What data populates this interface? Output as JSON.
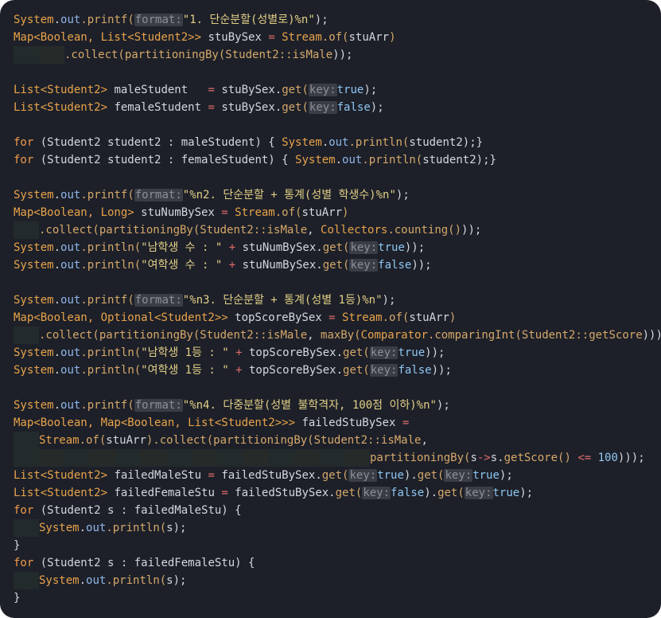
{
  "colors": {
    "background": "#1d2029",
    "type": "#e8a34a",
    "plain": "#d4d7de",
    "static_field": "#8fb6e8",
    "method": "#d6a86a",
    "string": "#e2cf86",
    "keyword": "#f09b4a",
    "number": "#8fc6f2",
    "operator": "#e06b6b",
    "hint": "#8b8f98"
  },
  "code_lines": [
    {
      "indent": 0,
      "tokens": [
        {
          "t": "System",
          "c": "type"
        },
        {
          "t": ".",
          "c": "plain"
        },
        {
          "t": "out",
          "c": "static_field"
        },
        {
          "t": ".printf(",
          "c": "method"
        },
        {
          "t": "format:",
          "c": "hint"
        },
        {
          "t": "\"1. 단순분할(성별로)%n\"",
          "c": "string"
        },
        {
          "t": ");",
          "c": "plain"
        }
      ]
    },
    {
      "indent": 0,
      "tokens": [
        {
          "t": "Map<Boolean, ",
          "c": "type"
        },
        {
          "t": "List<Student2>>",
          "c": "type"
        },
        {
          "t": " stuBySex ",
          "c": "plain"
        },
        {
          "t": "=",
          "c": "operator"
        },
        {
          "t": " Stream",
          "c": "type"
        },
        {
          "t": ".of(",
          "c": "method"
        },
        {
          "t": "stuArr",
          "c": "plain"
        },
        {
          "t": ")",
          "c": "method"
        }
      ]
    },
    {
      "indent": 2,
      "tokens": [
        {
          "t": ".collect(",
          "c": "method"
        },
        {
          "t": "partitioningBy(",
          "c": "method"
        },
        {
          "t": "Student2::isMale",
          "c": "method"
        },
        {
          "t": "));",
          "c": "plain"
        }
      ]
    },
    {
      "indent": 0,
      "tokens": []
    },
    {
      "indent": 0,
      "tokens": [
        {
          "t": "List<Student2>",
          "c": "type"
        },
        {
          "t": " maleStudent   ",
          "c": "plain"
        },
        {
          "t": "=",
          "c": "operator"
        },
        {
          "t": " stuBySex.",
          "c": "plain"
        },
        {
          "t": "get(",
          "c": "method"
        },
        {
          "t": "key:",
          "c": "hint"
        },
        {
          "t": "true",
          "c": "number"
        },
        {
          "t": ");",
          "c": "plain"
        }
      ]
    },
    {
      "indent": 0,
      "tokens": [
        {
          "t": "List<Student2>",
          "c": "type"
        },
        {
          "t": " femaleStudent ",
          "c": "plain"
        },
        {
          "t": "=",
          "c": "operator"
        },
        {
          "t": " stuBySex.",
          "c": "plain"
        },
        {
          "t": "get(",
          "c": "method"
        },
        {
          "t": "key:",
          "c": "hint"
        },
        {
          "t": "false",
          "c": "number"
        },
        {
          "t": ");",
          "c": "plain"
        }
      ]
    },
    {
      "indent": 0,
      "tokens": []
    },
    {
      "indent": 0,
      "tokens": [
        {
          "t": "for",
          "c": "keyword"
        },
        {
          "t": " (Student2 student2 : maleStudent) { ",
          "c": "plain"
        },
        {
          "t": "System",
          "c": "type"
        },
        {
          "t": ".",
          "c": "plain"
        },
        {
          "t": "out",
          "c": "static_field"
        },
        {
          "t": ".println(",
          "c": "method"
        },
        {
          "t": "student2",
          "c": "plain"
        },
        {
          "t": ");}",
          "c": "plain"
        }
      ]
    },
    {
      "indent": 0,
      "tokens": [
        {
          "t": "for",
          "c": "keyword"
        },
        {
          "t": " (Student2 student2 : femaleStudent) { ",
          "c": "plain"
        },
        {
          "t": "System",
          "c": "type"
        },
        {
          "t": ".",
          "c": "plain"
        },
        {
          "t": "out",
          "c": "static_field"
        },
        {
          "t": ".println(",
          "c": "method"
        },
        {
          "t": "student2",
          "c": "plain"
        },
        {
          "t": ");}",
          "c": "plain"
        }
      ]
    },
    {
      "indent": 0,
      "tokens": []
    },
    {
      "indent": 0,
      "tokens": [
        {
          "t": "System",
          "c": "type"
        },
        {
          "t": ".",
          "c": "plain"
        },
        {
          "t": "out",
          "c": "static_field"
        },
        {
          "t": ".printf(",
          "c": "method"
        },
        {
          "t": "format:",
          "c": "hint"
        },
        {
          "t": "\"%n2. 단순분할 + 통계(성별 학생수)%n\"",
          "c": "string"
        },
        {
          "t": ");",
          "c": "plain"
        }
      ]
    },
    {
      "indent": 0,
      "tokens": [
        {
          "t": "Map<Boolean, Long>",
          "c": "type"
        },
        {
          "t": " stuNumBySex ",
          "c": "plain"
        },
        {
          "t": "=",
          "c": "operator"
        },
        {
          "t": " Stream",
          "c": "type"
        },
        {
          "t": ".of(",
          "c": "method"
        },
        {
          "t": "stuArr",
          "c": "plain"
        },
        {
          "t": ")",
          "c": "method"
        }
      ]
    },
    {
      "indent": 1,
      "tokens": [
        {
          "t": ".collect(",
          "c": "method"
        },
        {
          "t": "partitioningBy(",
          "c": "method"
        },
        {
          "t": "Student2::isMale",
          "c": "method"
        },
        {
          "t": ", ",
          "c": "plain"
        },
        {
          "t": "Collectors",
          "c": "type"
        },
        {
          "t": ".counting()",
          "c": "method"
        },
        {
          "t": "));",
          "c": "plain"
        }
      ]
    },
    {
      "indent": 0,
      "tokens": [
        {
          "t": "System",
          "c": "type"
        },
        {
          "t": ".",
          "c": "plain"
        },
        {
          "t": "out",
          "c": "static_field"
        },
        {
          "t": ".println(",
          "c": "method"
        },
        {
          "t": "\"남학생 수 : \"",
          "c": "string"
        },
        {
          "t": " + ",
          "c": "operator"
        },
        {
          "t": "stuNumBySex.",
          "c": "plain"
        },
        {
          "t": "get(",
          "c": "method"
        },
        {
          "t": "key:",
          "c": "hint"
        },
        {
          "t": "true",
          "c": "number"
        },
        {
          "t": "));",
          "c": "plain"
        }
      ]
    },
    {
      "indent": 0,
      "tokens": [
        {
          "t": "System",
          "c": "type"
        },
        {
          "t": ".",
          "c": "plain"
        },
        {
          "t": "out",
          "c": "static_field"
        },
        {
          "t": ".println(",
          "c": "method"
        },
        {
          "t": "\"여학생 수 : \"",
          "c": "string"
        },
        {
          "t": " + ",
          "c": "operator"
        },
        {
          "t": "stuNumBySex.",
          "c": "plain"
        },
        {
          "t": "get(",
          "c": "method"
        },
        {
          "t": "key:",
          "c": "hint"
        },
        {
          "t": "false",
          "c": "number"
        },
        {
          "t": "));",
          "c": "plain"
        }
      ]
    },
    {
      "indent": 0,
      "tokens": []
    },
    {
      "indent": 0,
      "tokens": [
        {
          "t": "System",
          "c": "type"
        },
        {
          "t": ".",
          "c": "plain"
        },
        {
          "t": "out",
          "c": "static_field"
        },
        {
          "t": ".printf(",
          "c": "method"
        },
        {
          "t": "format:",
          "c": "hint"
        },
        {
          "t": "\"%n3. 단순분할 + 통계(성별 1등)%n\"",
          "c": "string"
        },
        {
          "t": ");",
          "c": "plain"
        }
      ]
    },
    {
      "indent": 0,
      "tokens": [
        {
          "t": "Map<Boolean, Optional<Student2>>",
          "c": "type"
        },
        {
          "t": " topScoreBySex ",
          "c": "plain"
        },
        {
          "t": "=",
          "c": "operator"
        },
        {
          "t": " Stream",
          "c": "type"
        },
        {
          "t": ".of(",
          "c": "method"
        },
        {
          "t": "stuArr",
          "c": "plain"
        },
        {
          "t": ")",
          "c": "method"
        }
      ]
    },
    {
      "indent": 1,
      "tokens": [
        {
          "t": ".collect(",
          "c": "method"
        },
        {
          "t": "partitioningBy(",
          "c": "method"
        },
        {
          "t": "Student2::isMale",
          "c": "method"
        },
        {
          "t": ", ",
          "c": "plain"
        },
        {
          "t": "maxBy(",
          "c": "method"
        },
        {
          "t": "Comparator",
          "c": "type"
        },
        {
          "t": ".comparingInt(",
          "c": "method"
        },
        {
          "t": "Student2::getScore",
          "c": "method"
        },
        {
          "t": "))));",
          "c": "plain"
        }
      ]
    },
    {
      "indent": 0,
      "tokens": [
        {
          "t": "System",
          "c": "type"
        },
        {
          "t": ".",
          "c": "plain"
        },
        {
          "t": "out",
          "c": "static_field"
        },
        {
          "t": ".println(",
          "c": "method"
        },
        {
          "t": "\"남학생 1등 : \"",
          "c": "string"
        },
        {
          "t": " + ",
          "c": "operator"
        },
        {
          "t": "topScoreBySex.",
          "c": "plain"
        },
        {
          "t": "get(",
          "c": "method"
        },
        {
          "t": "key:",
          "c": "hint"
        },
        {
          "t": "true",
          "c": "number"
        },
        {
          "t": "));",
          "c": "plain"
        }
      ]
    },
    {
      "indent": 0,
      "tokens": [
        {
          "t": "System",
          "c": "type"
        },
        {
          "t": ".",
          "c": "plain"
        },
        {
          "t": "out",
          "c": "static_field"
        },
        {
          "t": ".println(",
          "c": "method"
        },
        {
          "t": "\"여학생 1등 : \"",
          "c": "string"
        },
        {
          "t": " + ",
          "c": "operator"
        },
        {
          "t": "topScoreBySex.",
          "c": "plain"
        },
        {
          "t": "get(",
          "c": "method"
        },
        {
          "t": "key:",
          "c": "hint"
        },
        {
          "t": "false",
          "c": "number"
        },
        {
          "t": "));",
          "c": "plain"
        }
      ]
    },
    {
      "indent": 0,
      "tokens": []
    },
    {
      "indent": 0,
      "tokens": [
        {
          "t": "System",
          "c": "type"
        },
        {
          "t": ".",
          "c": "plain"
        },
        {
          "t": "out",
          "c": "static_field"
        },
        {
          "t": ".printf(",
          "c": "method"
        },
        {
          "t": "format:",
          "c": "hint"
        },
        {
          "t": "\"%n4. 다중분할(성별 불학격자, 100점 이하)%n\"",
          "c": "string"
        },
        {
          "t": ");",
          "c": "plain"
        }
      ]
    },
    {
      "indent": 0,
      "tokens": [
        {
          "t": "Map<Boolean, Map<Boolean, List<Student2>>>",
          "c": "type"
        },
        {
          "t": " failedStuBySex ",
          "c": "plain"
        },
        {
          "t": "=",
          "c": "operator"
        }
      ]
    },
    {
      "indent": 1,
      "tokens": [
        {
          "t": "Stream",
          "c": "type"
        },
        {
          "t": ".of(",
          "c": "method"
        },
        {
          "t": "stuArr",
          "c": "plain"
        },
        {
          "t": ").collect(",
          "c": "method"
        },
        {
          "t": "partitioningBy(",
          "c": "method"
        },
        {
          "t": "Student2::isMale",
          "c": "method"
        },
        {
          "t": ",",
          "c": "plain"
        }
      ]
    },
    {
      "indent": 14,
      "tokens": [
        {
          "t": "partitioningBy(",
          "c": "method"
        },
        {
          "t": "s",
          "c": "plain"
        },
        {
          "t": "->",
          "c": "operator"
        },
        {
          "t": "s.",
          "c": "plain"
        },
        {
          "t": "getScore()",
          "c": "method"
        },
        {
          "t": " <= ",
          "c": "operator"
        },
        {
          "t": "100",
          "c": "number"
        },
        {
          "t": ")));",
          "c": "plain"
        }
      ]
    },
    {
      "indent": 0,
      "tokens": [
        {
          "t": "List<Student2>",
          "c": "type"
        },
        {
          "t": " failedMaleStu ",
          "c": "plain"
        },
        {
          "t": "=",
          "c": "operator"
        },
        {
          "t": " failedStuBySex.",
          "c": "plain"
        },
        {
          "t": "get(",
          "c": "method"
        },
        {
          "t": "key:",
          "c": "hint"
        },
        {
          "t": "true",
          "c": "number"
        },
        {
          "t": ").",
          "c": "plain"
        },
        {
          "t": "get(",
          "c": "method"
        },
        {
          "t": "key:",
          "c": "hint"
        },
        {
          "t": "true",
          "c": "number"
        },
        {
          "t": ");",
          "c": "plain"
        }
      ]
    },
    {
      "indent": 0,
      "tokens": [
        {
          "t": "List<Student2>",
          "c": "type"
        },
        {
          "t": " failedFemaleStu ",
          "c": "plain"
        },
        {
          "t": "=",
          "c": "operator"
        },
        {
          "t": " failedStuBySex.",
          "c": "plain"
        },
        {
          "t": "get(",
          "c": "method"
        },
        {
          "t": "key:",
          "c": "hint"
        },
        {
          "t": "false",
          "c": "number"
        },
        {
          "t": ").",
          "c": "plain"
        },
        {
          "t": "get(",
          "c": "method"
        },
        {
          "t": "key:",
          "c": "hint"
        },
        {
          "t": "true",
          "c": "number"
        },
        {
          "t": ");",
          "c": "plain"
        }
      ]
    },
    {
      "indent": 0,
      "tokens": [
        {
          "t": "for",
          "c": "keyword"
        },
        {
          "t": " (Student2 s : failedMaleStu) {",
          "c": "plain"
        }
      ]
    },
    {
      "indent": 1,
      "tokens": [
        {
          "t": "System",
          "c": "type"
        },
        {
          "t": ".",
          "c": "plain"
        },
        {
          "t": "out",
          "c": "static_field"
        },
        {
          "t": ".println(",
          "c": "method"
        },
        {
          "t": "s",
          "c": "plain"
        },
        {
          "t": ");",
          "c": "plain"
        }
      ]
    },
    {
      "indent": 0,
      "tokens": [
        {
          "t": "}",
          "c": "plain"
        }
      ]
    },
    {
      "indent": 0,
      "tokens": [
        {
          "t": "for",
          "c": "keyword"
        },
        {
          "t": " (Student2 s : failedFemaleStu) {",
          "c": "plain"
        }
      ]
    },
    {
      "indent": 1,
      "tokens": [
        {
          "t": "System",
          "c": "type"
        },
        {
          "t": ".",
          "c": "plain"
        },
        {
          "t": "out",
          "c": "static_field"
        },
        {
          "t": ".println(",
          "c": "method"
        },
        {
          "t": "s",
          "c": "plain"
        },
        {
          "t": ");",
          "c": "plain"
        }
      ]
    },
    {
      "indent": 0,
      "tokens": [
        {
          "t": "}",
          "c": "plain"
        }
      ]
    }
  ]
}
